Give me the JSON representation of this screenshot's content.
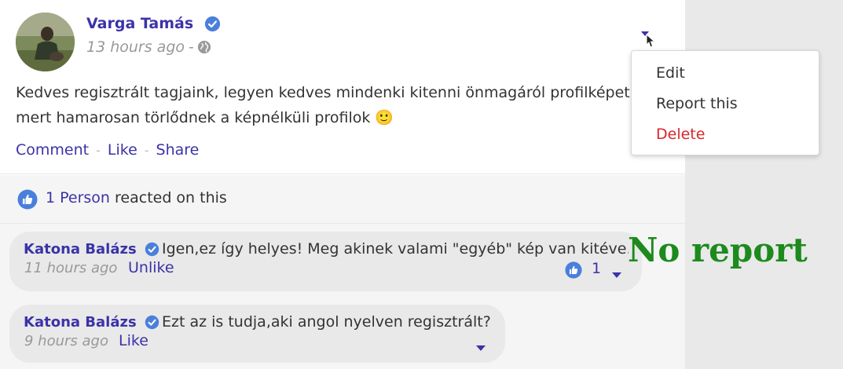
{
  "post": {
    "author": "Varga Tamás",
    "time": "13 hours ago",
    "time_separator": "-",
    "body_line1": "Kedves regisztrált tagjaink, legyen kedves mindenki kitenni önmagáról profilképet,",
    "body_line2": "mert hamarosan törlődnek a képnélküli profilok 🙂",
    "actions": {
      "comment": "Comment",
      "like": "Like",
      "share": "Share",
      "separator": "-"
    }
  },
  "menu": {
    "items": [
      {
        "label": "Edit"
      },
      {
        "label": "Report this"
      },
      {
        "label": "Delete"
      }
    ]
  },
  "reactions": {
    "count_link": "1 Person",
    "suffix": " reacted on this"
  },
  "comments": [
    {
      "author": "Katona Balázs",
      "text": "Igen,ez így helyes! Meg akinek valami \"egyéb\" kép van kitéve...",
      "time": "11 hours ago",
      "action": "Unlike",
      "like_count": "1"
    },
    {
      "author": "Katona Balázs",
      "text": "Ezt az is tudja,aki angol nyelven regisztrált?",
      "time": "9 hours ago",
      "action": "Like"
    }
  ],
  "annotation": "No report",
  "colors": {
    "link": "#3b33a8",
    "verified": "#4a7fdc",
    "danger": "#d9262b",
    "annotation": "#1d8a1d"
  },
  "icons": {
    "verified": "verified-badge-icon",
    "globe": "globe-icon",
    "like": "thumbs-up-icon",
    "caret": "caret-down-icon"
  }
}
